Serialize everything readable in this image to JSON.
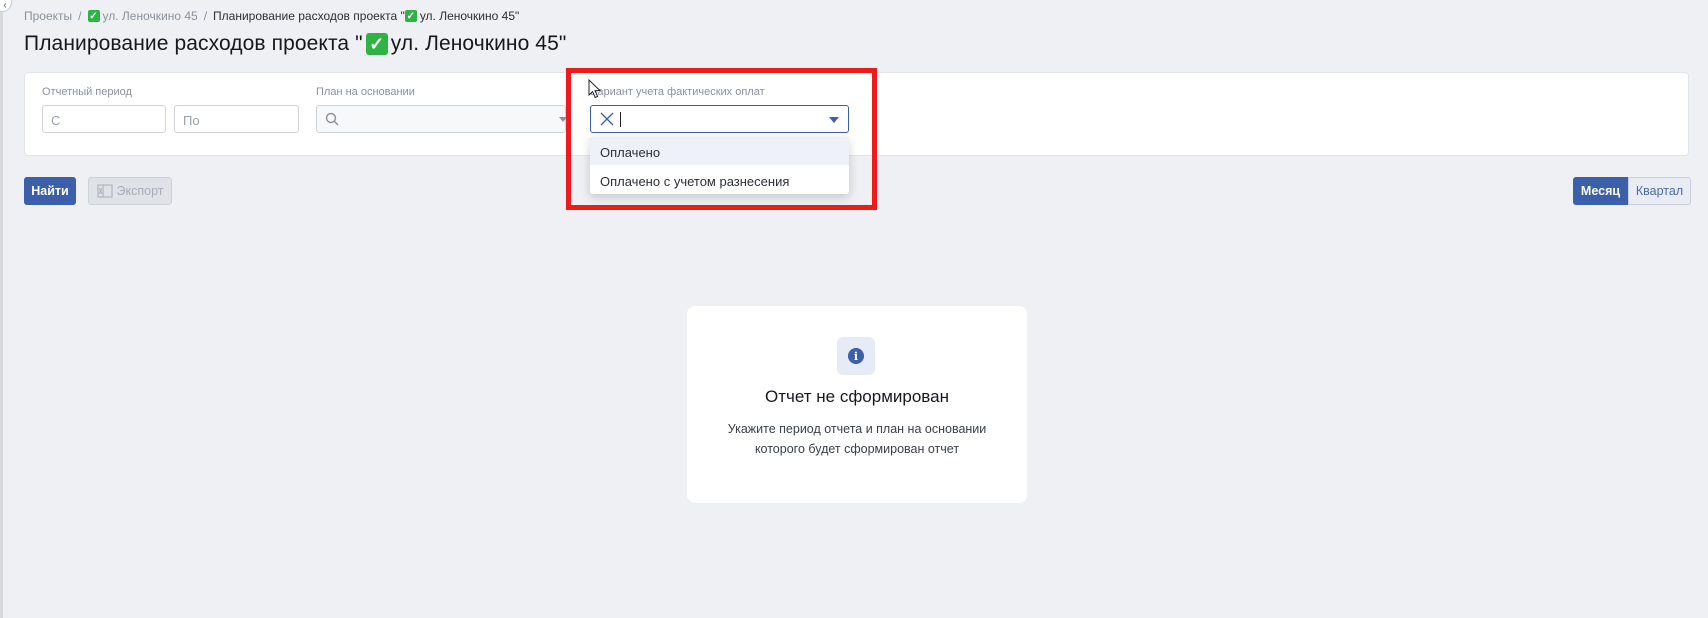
{
  "breadcrumb": {
    "items": [
      "Проекты",
      "ул. Леночкино 45",
      "Планирование расходов проекта \"",
      "ул. Леночкино 45\""
    ],
    "separator": "/"
  },
  "page": {
    "title_prefix": "Планирование расходов проекта \"",
    "title_suffix": "ул. Леночкино 45\"",
    "check_glyph": "✓"
  },
  "filters": {
    "period_label": "Отчетный период",
    "from_placeholder": "С",
    "to_placeholder": "По",
    "plan_label": "План на основании",
    "variant_label": "Вариант учета фактических оплат",
    "variant_options": [
      "Оплачено",
      "Оплачено с учетом разнесения"
    ]
  },
  "toolbar": {
    "find_label": "Найти",
    "export_label": "Экспорт",
    "period_toggle": [
      "Месяц",
      "Квартал"
    ]
  },
  "empty_state": {
    "icon_glyph": "i",
    "title": "Отчет не сформирован",
    "description": "Укажите период отчета и план на основании которого будет сформирован отчет"
  },
  "colors": {
    "accent": "#3c5fa9",
    "highlight": "#ee1b1b",
    "check": "#2fb344",
    "background": "#eef0f3"
  }
}
